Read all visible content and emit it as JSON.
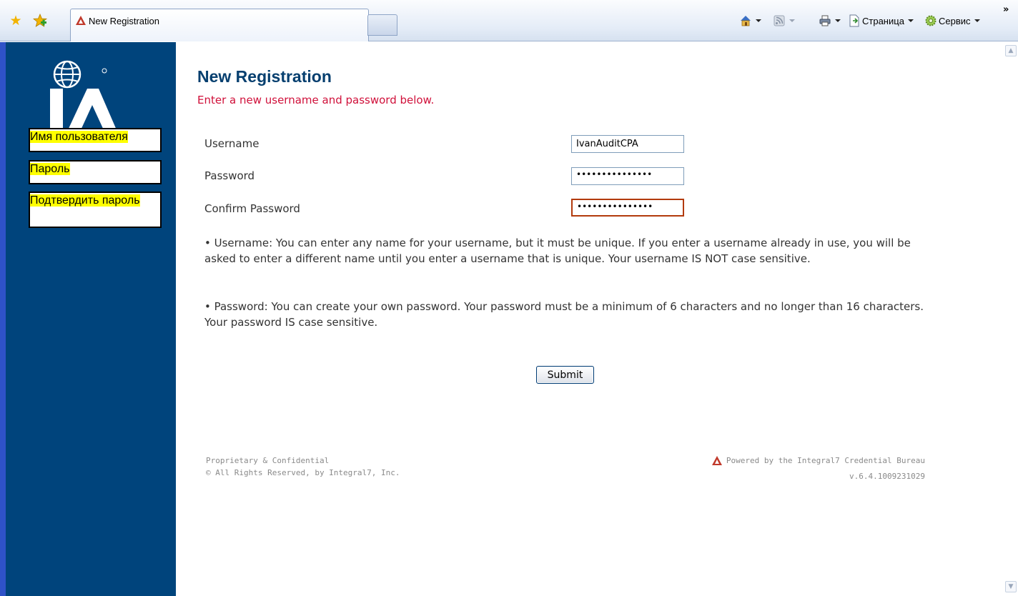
{
  "browser": {
    "tab_title": "New Registration",
    "commands": {
      "page_label": "Страница",
      "tools_label": "Сервис"
    }
  },
  "sidebar": {
    "overlay_labels": [
      "Имя пользователя",
      "Пароль",
      "Подтвердить пароль"
    ]
  },
  "form": {
    "title": "New Registration",
    "subtitle": "Enter a new username and password below.",
    "username_label": "Username",
    "username_value": "IvanAuditCPA",
    "password_label": "Password",
    "password_mask": "•••••••••••••••",
    "confirm_label": "Confirm Password",
    "confirm_mask": "•••••••••••••••",
    "note_username": "• Username: You can enter any name for your username, but it must be unique. If you enter a username already in use, you will be asked to enter a different name until you enter a username that is unique. Your username IS NOT case sensitive.",
    "note_password": "• Password: You can create your own password. Your password must be a minimum of 6 characters and no longer than 16 characters. Your password IS case sensitive.",
    "submit_label": "Submit"
  },
  "footer": {
    "proprietary": "Proprietary & Confidential",
    "rights": "© All Rights Reserved, by Integral7, Inc.",
    "powered_by": "Powered by the Integral7 Credential Bureau",
    "version": "v.6.4.1009231029"
  },
  "colors": {
    "sidebar_bg": "#00447c",
    "title": "#063f6f",
    "subtitle": "#d0103a",
    "highlight": "#ffff00"
  }
}
